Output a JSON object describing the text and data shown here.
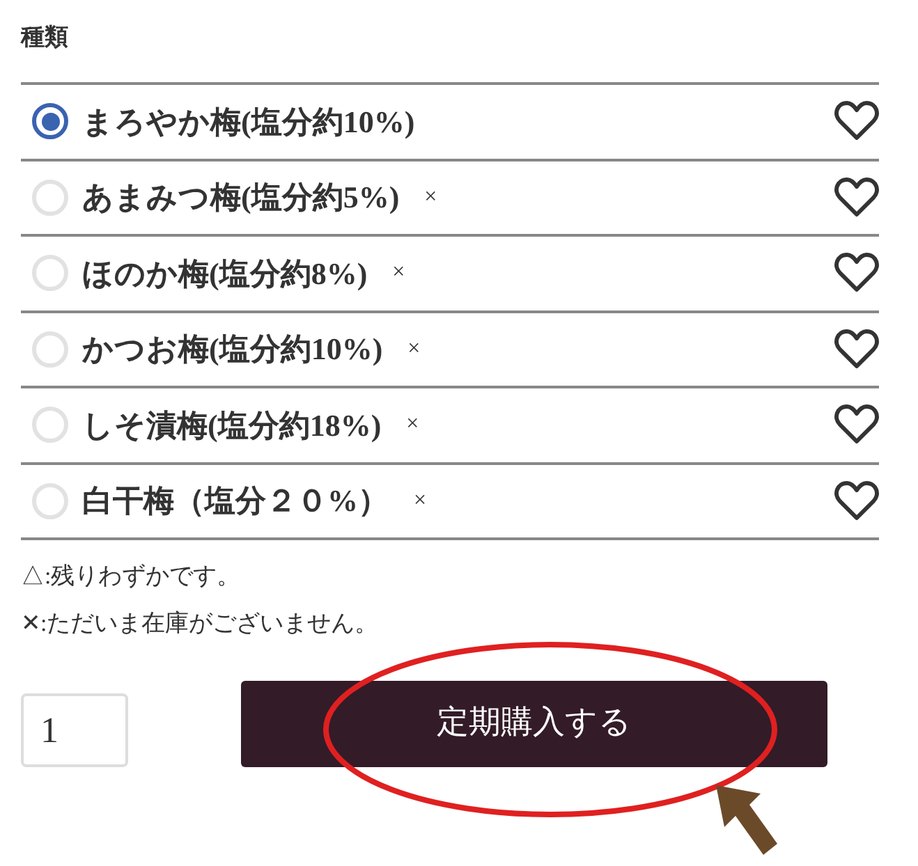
{
  "section_title": "種類",
  "options": [
    {
      "label": "まろやか梅(塩分約10%)",
      "selected": true
    },
    {
      "label": "あまみつ梅(塩分約5%)",
      "selected": false,
      "stock_mark": "×"
    },
    {
      "label": "ほのか梅(塩分約8%)",
      "selected": false,
      "stock_mark": "×"
    },
    {
      "label": "かつお梅(塩分約10%)",
      "selected": false,
      "stock_mark": "×"
    },
    {
      "label": "しそ漬梅(塩分約18%)",
      "selected": false,
      "stock_mark": "×"
    },
    {
      "label": "白干梅（塩分２０%）",
      "selected": false,
      "stock_mark": "×"
    }
  ],
  "legend": [
    "△:残りわずかです。",
    "✕:ただいま在庫がございません。"
  ],
  "quantity": "1",
  "button": "定期購入する"
}
